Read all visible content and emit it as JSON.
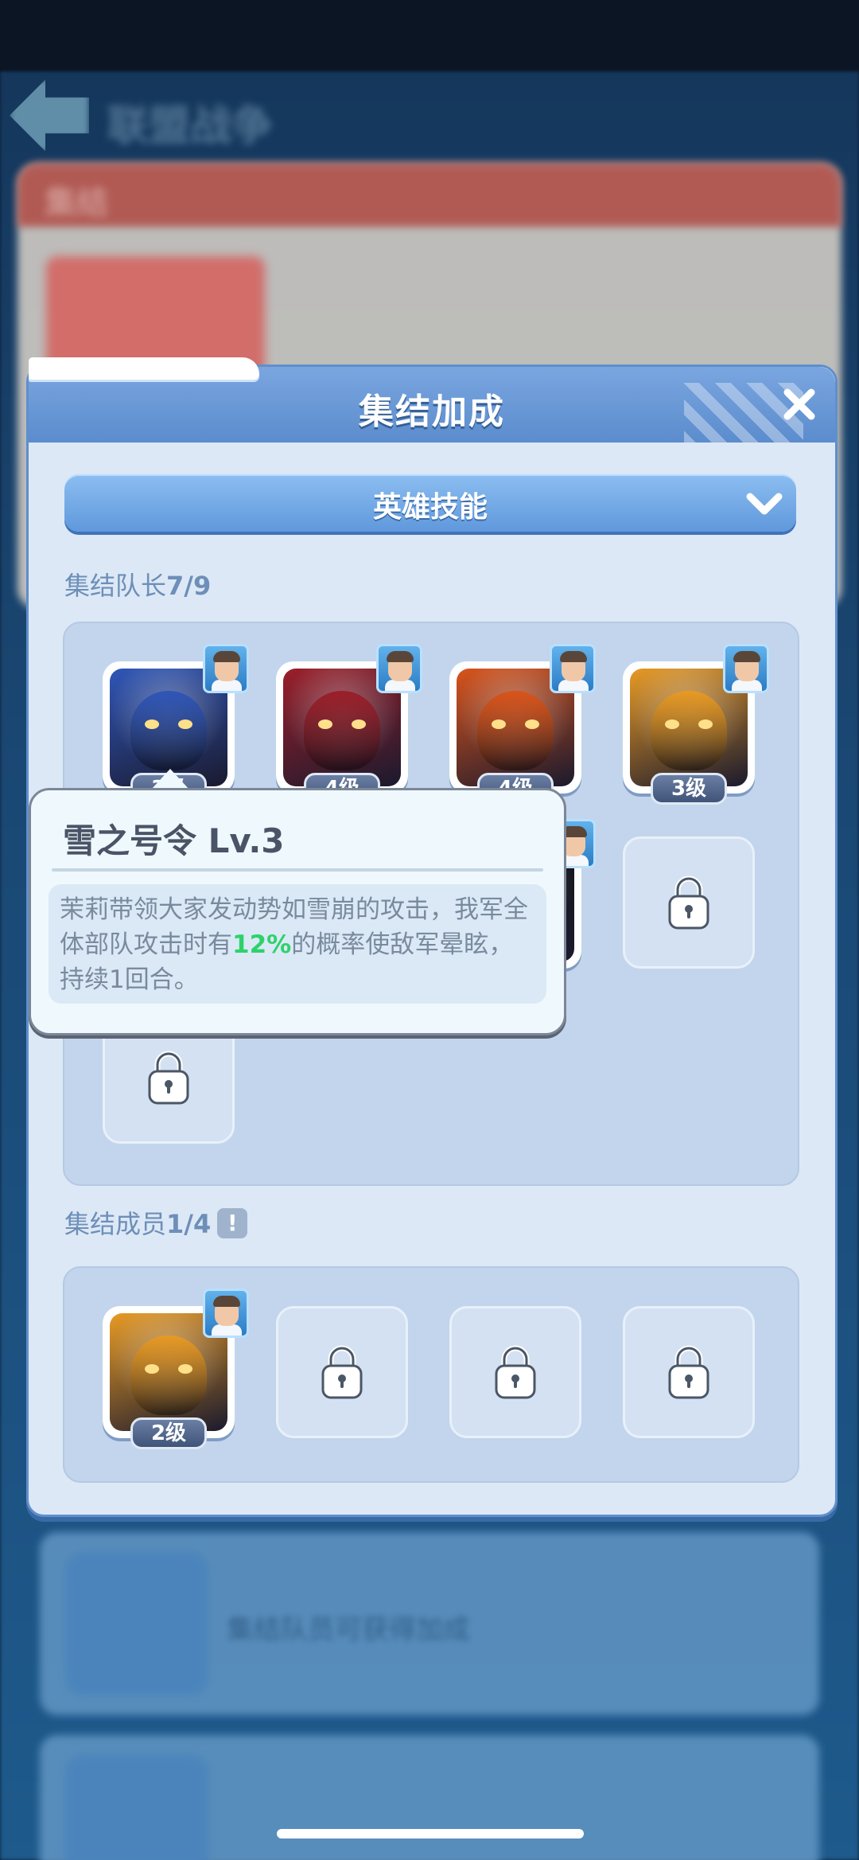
{
  "background": {
    "page_title": "联盟战争",
    "card_header": "集结",
    "list_row_text": "集结队员可获得加成"
  },
  "dialog": {
    "title": "集结加成",
    "dropdown_label": "英雄技能",
    "leader_section": {
      "label": "集结队长",
      "count": "7/9"
    },
    "member_section": {
      "label": "集结成员",
      "count": "1/4",
      "warn_glyph": "!"
    },
    "leader_slots": [
      {
        "type": "hero",
        "level": "3级",
        "art": "storm-hero",
        "color": "#2f56b8"
      },
      {
        "type": "hero",
        "level": "4级",
        "art": "crimson-hero",
        "color": "#9b1f2a"
      },
      {
        "type": "hero",
        "level": "4级",
        "art": "flame-hero",
        "color": "#d9541b"
      },
      {
        "type": "hero",
        "level": "3级",
        "art": "lion-hero",
        "color": "#e89a24"
      },
      {
        "type": "hero",
        "level": "",
        "art": "hidden-hero",
        "color": "#3a2a22"
      },
      {
        "type": "hero",
        "level": "",
        "art": "hidden-hero",
        "color": "#3a2a22"
      },
      {
        "type": "hero",
        "level": "",
        "art": "hidden-hero",
        "color": "#151515"
      },
      {
        "type": "locked"
      },
      {
        "type": "locked"
      }
    ],
    "member_slots": [
      {
        "type": "hero",
        "level": "2级",
        "art": "lion-hero",
        "color": "#e89a24"
      },
      {
        "type": "locked"
      },
      {
        "type": "locked"
      },
      {
        "type": "locked"
      }
    ]
  },
  "tooltip": {
    "title": "雪之号令 Lv.3",
    "text_before": "茉莉带领大家发动势如雪崩的攻击，我军全体部队攻击时有",
    "highlight": "12%",
    "text_after": "的概率使敌军晕眩，持续1回合。",
    "highlight_color": "#2ed26b"
  }
}
